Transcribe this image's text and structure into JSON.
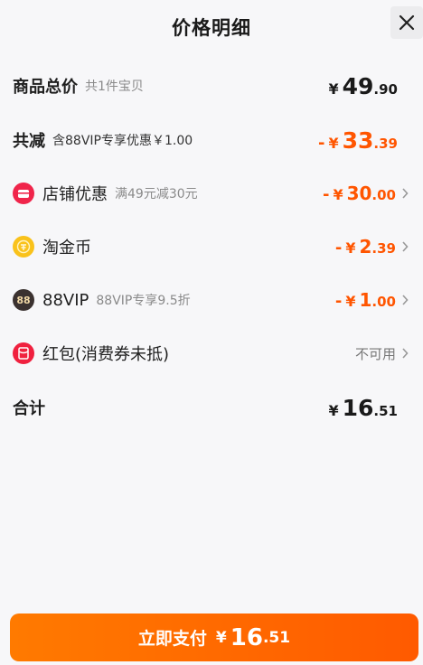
{
  "header": {
    "title": "价格明细"
  },
  "subtotal": {
    "label": "商品总价",
    "sub": "共1件宝贝",
    "yen": "¥",
    "int": "49",
    "dec": ".90"
  },
  "reduction": {
    "label": "共减",
    "sub": "含88VIP专享优惠￥1.00",
    "sign": "-",
    "yen": "¥",
    "int": "33",
    "dec": ".39"
  },
  "discounts": [
    {
      "label": "店铺优惠",
      "sub": "满49元减30元",
      "sign": "-",
      "yen": "¥",
      "int": "30",
      "dec": ".00",
      "icon": "shop-icon"
    },
    {
      "label": "淘金币",
      "sub": "",
      "sign": "-",
      "yen": "¥",
      "int": "2",
      "dec": ".39",
      "icon": "gold-coin-icon"
    },
    {
      "label": "88VIP",
      "sub": "88VIP专享9.5折",
      "sign": "-",
      "yen": "¥",
      "int": "1",
      "dec": ".00",
      "icon": "vip-88-icon",
      "icon_text": "88"
    },
    {
      "label": "红包(消费券未抵)",
      "status": "不可用",
      "icon": "red-packet-icon"
    }
  ],
  "total": {
    "label": "合计",
    "yen": "¥",
    "int": "16",
    "dec": ".51"
  },
  "pay_button": {
    "label": "立即支付",
    "yen": "¥",
    "int": "16",
    "dec": ".51"
  },
  "colors": {
    "accent": "#ff5500",
    "button": "#ff6a00",
    "background": "#f7f7f9"
  }
}
